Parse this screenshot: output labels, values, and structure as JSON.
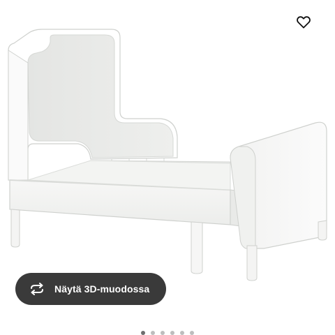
{
  "product": {
    "image_alt": "white extendable children's bed"
  },
  "actions": {
    "favourite_icon": "heart-outline-icon",
    "view_3d_label": "Näytä 3D-muodossa",
    "view_3d_icon": "rotate-arrows-icon"
  },
  "carousel": {
    "dot_count": 6,
    "active_index": 0
  },
  "colors": {
    "button_bg": "#3a3a3a",
    "button_text": "#ffffff",
    "icon_stroke": "#111111"
  }
}
